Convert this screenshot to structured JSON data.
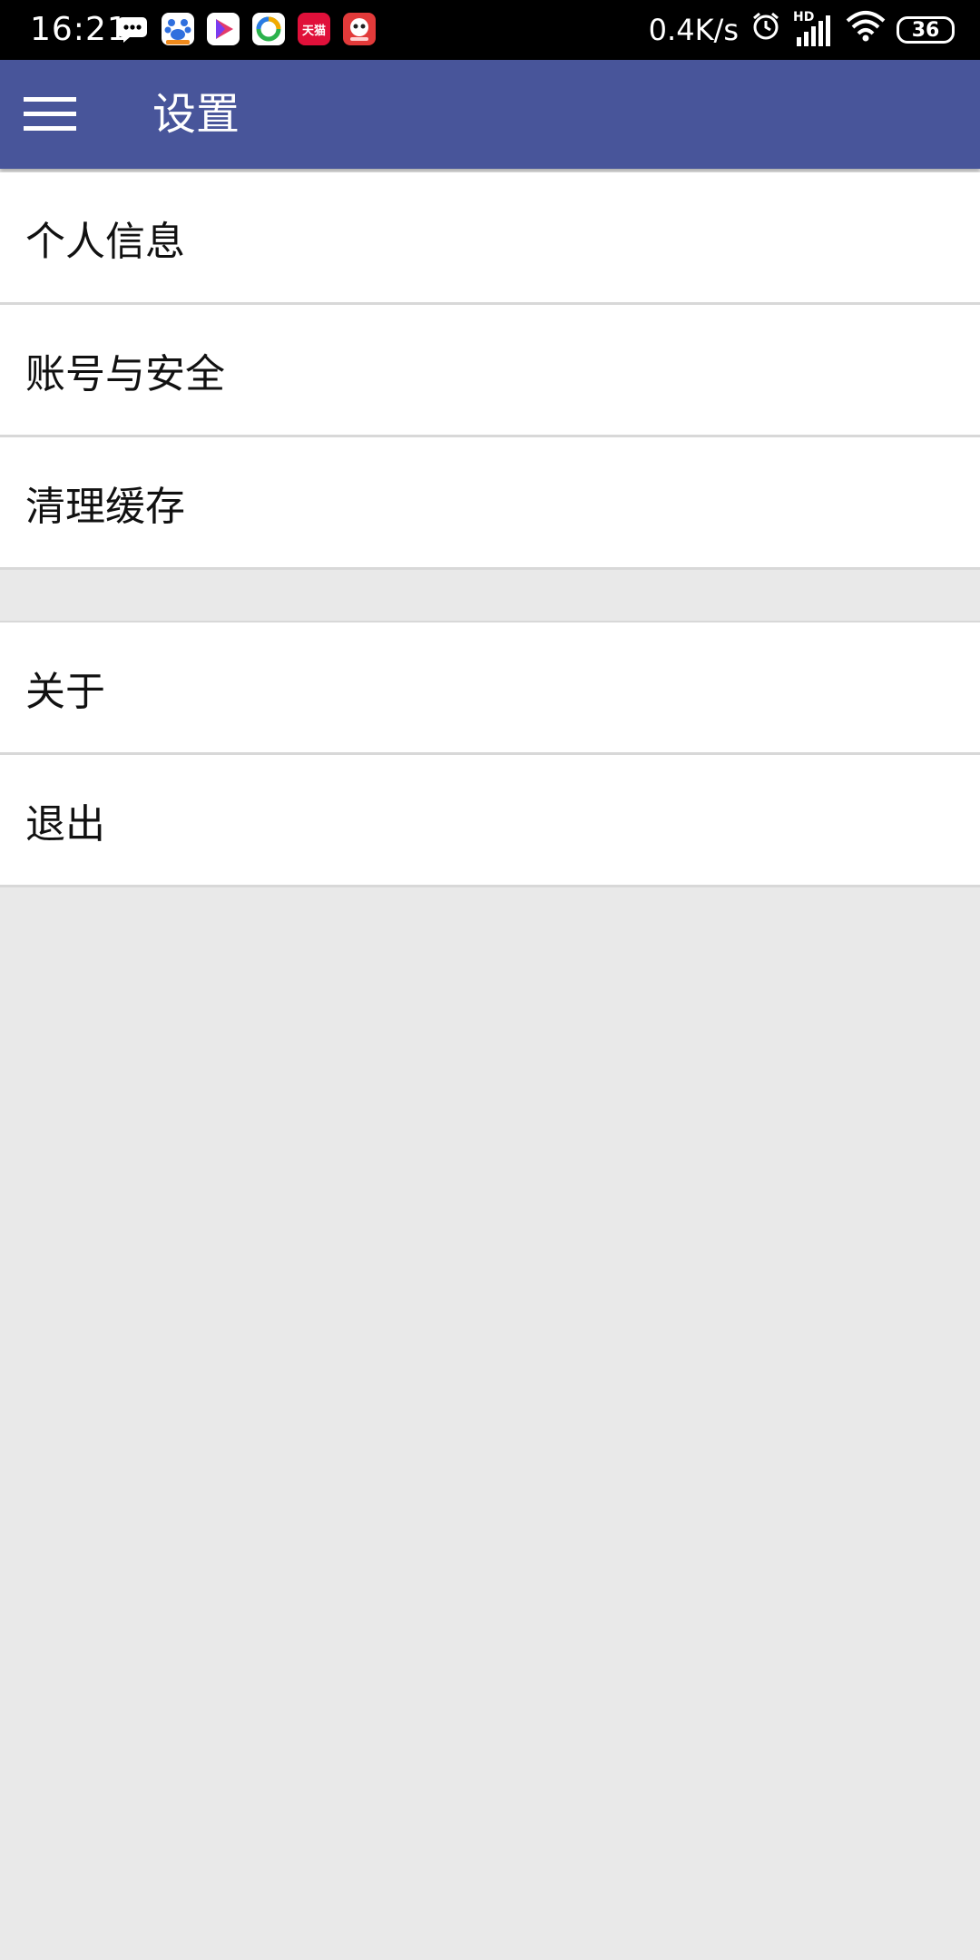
{
  "status_bar": {
    "time": "16:21",
    "network_speed": "0.4K/s",
    "signal_label": "HD",
    "battery": "36",
    "app_icons": [
      {
        "name": "message-icon",
        "color": "#ffffff"
      },
      {
        "name": "baidu-icon",
        "color": "#2f6fde"
      },
      {
        "name": "video-icon",
        "color": "#e23a6b"
      },
      {
        "name": "ring-icon",
        "color": "#2bb24c"
      },
      {
        "name": "tmall-icon",
        "color": "#e0103a",
        "text": "天猫"
      },
      {
        "name": "mascot-icon",
        "color": "#e23a3a"
      }
    ]
  },
  "app_bar": {
    "title": "设置",
    "menu_icon": "hamburger-menu-icon",
    "background": "#48559a"
  },
  "settings": {
    "group1": [
      {
        "label": "个人信息"
      },
      {
        "label": "账号与安全"
      },
      {
        "label": "清理缓存"
      }
    ],
    "group2": [
      {
        "label": "关于"
      },
      {
        "label": "退出"
      }
    ]
  }
}
